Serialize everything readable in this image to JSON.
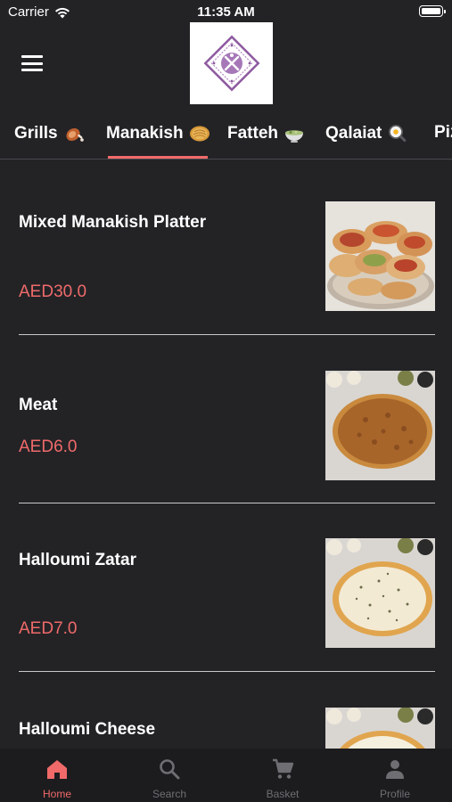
{
  "status_bar": {
    "carrier": "Carrier",
    "time": "11:35 AM"
  },
  "tabs": [
    {
      "label": "Grills",
      "icon": "meat-emoji-icon"
    },
    {
      "label": "Manakish",
      "icon": "flatbread-emoji-icon",
      "active": true
    },
    {
      "label": "Fatteh",
      "icon": "bowl-emoji-icon"
    },
    {
      "label": "Qalaiat",
      "icon": "pan-emoji-icon"
    },
    {
      "label": "Piz",
      "icon": ""
    }
  ],
  "menu_items": [
    {
      "name": "Mixed Manakish Platter",
      "price": "AED30.0"
    },
    {
      "name": "Meat",
      "price": "AED6.0"
    },
    {
      "name": "Halloumi Zatar",
      "price": "AED7.0"
    },
    {
      "name": "Halloumi Cheese",
      "price": ""
    }
  ],
  "bottom_nav": [
    {
      "label": "Home",
      "icon": "home-icon",
      "active": true
    },
    {
      "label": "Search",
      "icon": "search-icon"
    },
    {
      "label": "Basket",
      "icon": "cart-icon"
    },
    {
      "label": "Profile",
      "icon": "person-icon"
    }
  ],
  "colors": {
    "background": "#232326",
    "accent": "#f06a6a",
    "nav_bg": "#1c1c1e",
    "inactive": "#6e6e73"
  }
}
